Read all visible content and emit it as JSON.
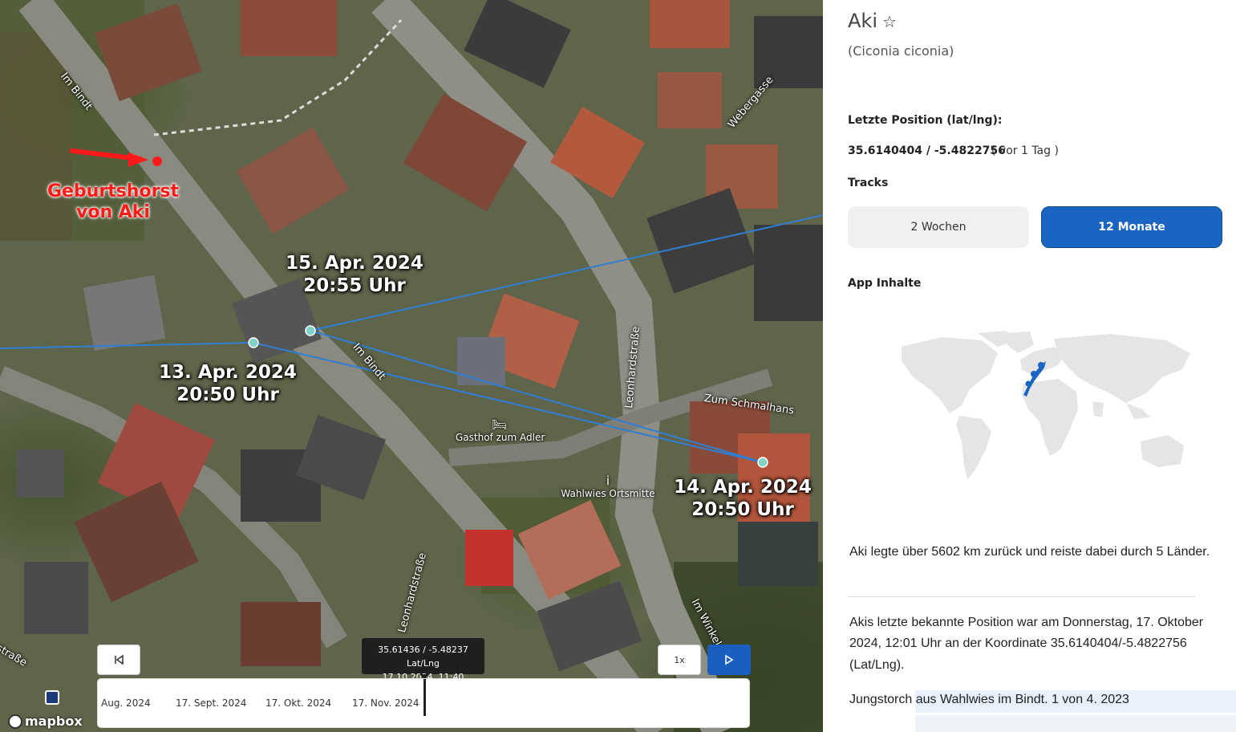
{
  "map": {
    "annotations": {
      "track_a_date": "15. Apr. 2024",
      "track_a_time": "20:55 Uhr",
      "track_b_date": "13. Apr. 2024",
      "track_b_time": "20:50 Uhr",
      "track_c_date": "14. Apr. 2024",
      "track_c_time": "20:50 Uhr",
      "birth_line1": "Geburtshorst",
      "birth_line2": "von Aki"
    },
    "streets": {
      "im_bindt_top": "Im Bindt",
      "im_bindt_mid": "Im Bindt",
      "webergasse": "Webergasse",
      "leonhardstrasse_mid": "Leonhardstraße",
      "leonhardstrasse_low": "Leonhardstraße",
      "zum_schmalhans": "Zum Schmalhans",
      "im_winkel": "Im Winkel",
      "strasse_left": "straße"
    },
    "pois": {
      "gasthof": "Gasthof zum Adler",
      "ortsmitte": "Wahlwies Ortsmitte"
    },
    "track_color": "#2f7fd6",
    "point_color": "#7fd3c8",
    "birth_color": "#ff1a1a",
    "attribution": "mapbox"
  },
  "timeline": {
    "tooltip_coords": "35.61436 / -5.48237 Lat/Lng",
    "tooltip_datetime": "17.10.2024, 11:40",
    "ticks": [
      "Aug. 2024",
      "17. Sept. 2024",
      "17. Okt. 2024",
      "17. Nov. 2024"
    ],
    "speed_label": "1x",
    "rewind_icon": "skip-back-icon",
    "play_icon": "play-icon"
  },
  "panel": {
    "name": "Aki",
    "latin": "(Ciconia ciconia)",
    "position_label": "Letzte Position (lat/lng):",
    "position_value": "35.6140404 / -5.4822756",
    "position_age": "( vor 1 Tag )",
    "tracks_label": "Tracks",
    "btn_2w": "2 Wochen",
    "btn_12m": "12 Monate",
    "app_label": "App Inhalte",
    "stat_text": "Aki legte über 5602 km zurück und reiste dabei durch 5 Länder.",
    "last_pos_text": "Akis letzte bekannte Position war am Donnerstag, 17. Oktober 2024, 12:01 Uhr an der Koordinate 35.6140404/-5.4822756 (Lat/Lng).",
    "bio_text": "Jungstorch aus Wahlwies im Bindt. 1 von 4. 2023",
    "accent": "#1a64c2"
  }
}
